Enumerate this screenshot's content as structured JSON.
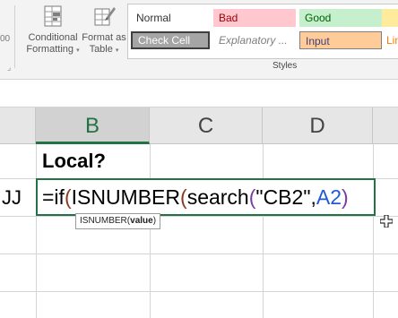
{
  "ribbon": {
    "left_fragment": "00",
    "conditional_formatting": {
      "line1": "Conditional",
      "line2": "Formatting"
    },
    "format_as_table": {
      "line1": "Format as",
      "line2": "Table"
    },
    "styles_gallery": [
      {
        "label": "Normal",
        "bg": "#ffffff",
        "fg": "#333333"
      },
      {
        "label": "Bad",
        "bg": "#ffc7ce",
        "fg": "#9c0006"
      },
      {
        "label": "Good",
        "bg": "#c6efce",
        "fg": "#006100"
      },
      {
        "label": "Check Cell",
        "bg": "#a5a5a5",
        "fg": "#ffffff"
      },
      {
        "label": "Explanatory ...",
        "bg": "#ffffff",
        "fg": "#7f7f7f"
      },
      {
        "label": "Input",
        "bg": "#ffcc99",
        "fg": "#3f3f76"
      },
      {
        "label": "Lin",
        "bg": "#ffffff",
        "fg": "#fa7d00"
      }
    ],
    "group_label": "Styles"
  },
  "grid": {
    "columns": [
      "B",
      "C",
      "D"
    ],
    "selected_column": "B",
    "cells": {
      "B1": "Local?",
      "A2": "JJ"
    },
    "editing_formula": {
      "eq_if": "=if",
      "paren_open_1": "(",
      "fn_isnumber": "ISNUMBER",
      "paren_open_2": "(",
      "fn_search": "search",
      "paren_open_3": "(",
      "string_arg": "\"CB2\"",
      "comma": ",",
      "ref_arg": "A2",
      "paren_close_3": ")"
    },
    "tooltip": {
      "fn": "ISNUMBER",
      "open": "(",
      "arg": "value",
      "close": ")"
    }
  },
  "colors": {
    "accent": "#217346",
    "ref_blue": "#1f5bd6",
    "paren_purple": "#7b3aa8",
    "paren_brown": "#8b3a1f"
  }
}
